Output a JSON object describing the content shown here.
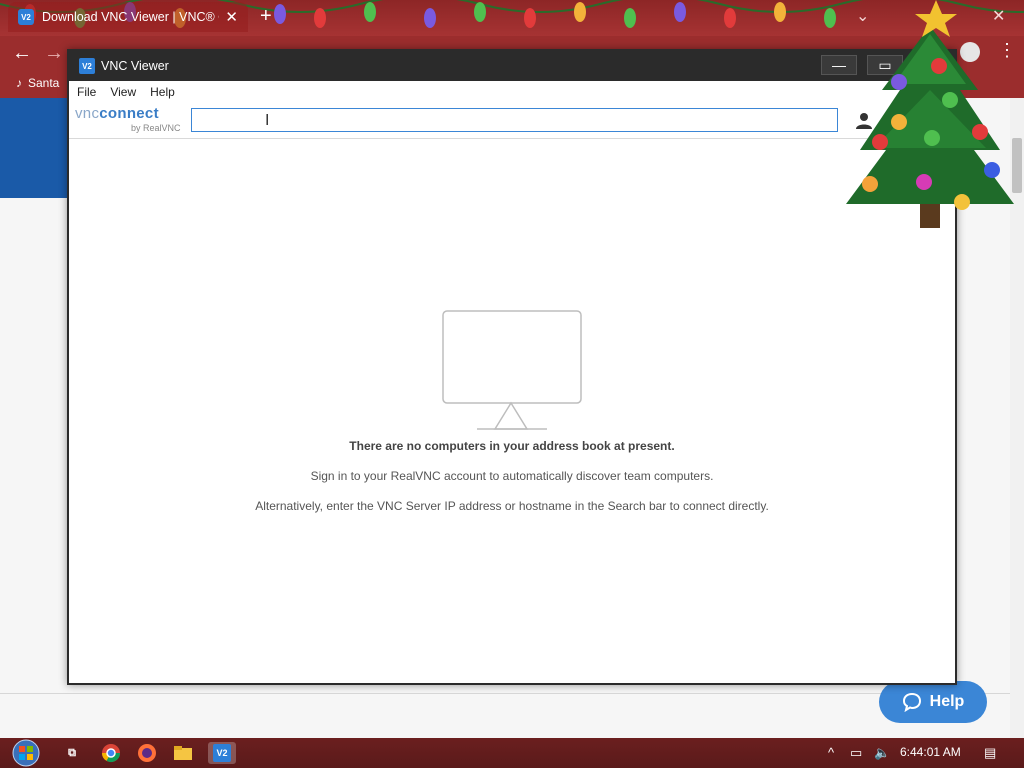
{
  "browser": {
    "tab_title": "Download VNC Viewer | VNC® C",
    "tab_icon": "V2",
    "bookmark_label": "Santa"
  },
  "vnc_window": {
    "title": "VNC Viewer",
    "app_icon": "V2",
    "menu": {
      "file": "File",
      "view": "View",
      "help": "Help"
    },
    "logo": {
      "main_light": "vnc",
      "main_bold": "connect",
      "sub": "by RealVNC"
    },
    "search": {
      "value": "",
      "placeholder": ""
    },
    "empty_state": {
      "title": "There are no computers in your address book at present.",
      "line1": "Sign in to your RealVNC account to automatically discover team computers.",
      "line2": "Alternatively, enter the VNC Server IP address or hostname in the Search bar to connect directly."
    }
  },
  "help_widget": {
    "label": "Help"
  },
  "taskbar": {
    "clock": "6:44:01 AM",
    "vnc_icon": "V2"
  },
  "colors": {
    "accent": "#3b86d6",
    "window_titlebar": "#2b2b2b",
    "browser_chrome": "#9b2d2d"
  }
}
